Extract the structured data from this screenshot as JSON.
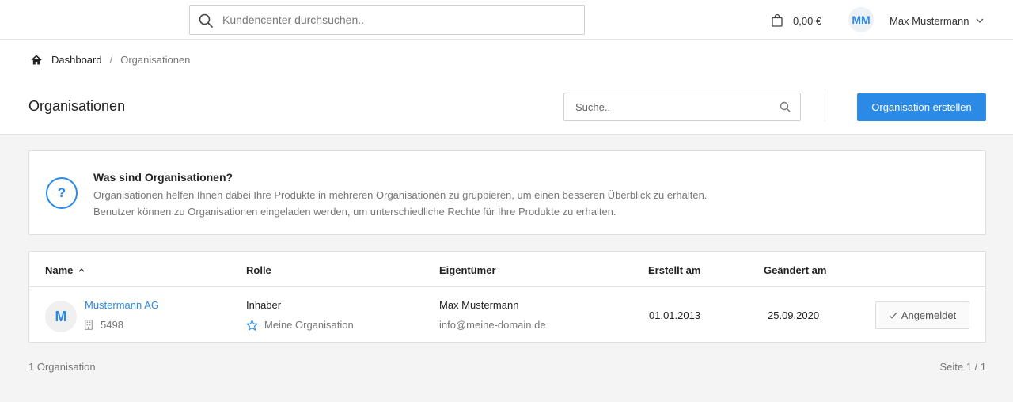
{
  "topbar": {
    "search_placeholder": "Kundencenter durchsuchen..",
    "cart_total": "0,00 €",
    "user_initials": "MM",
    "user_name": "Max Mustermann"
  },
  "breadcrumb": {
    "home_label": "Dashboard",
    "separator": "/",
    "current": "Organisationen"
  },
  "page": {
    "title": "Organisationen",
    "search_placeholder": "Suche..",
    "create_button": "Organisation erstellen"
  },
  "info": {
    "icon": "question-icon",
    "icon_glyph": "?",
    "title": "Was sind Organisationen?",
    "line1": "Organisationen helfen Ihnen dabei Ihre Produkte in mehreren Organisationen zu gruppieren, um einen besseren Überblick zu erhalten.",
    "line2": "Benutzer können zu Organisationen eingeladen werden, um unterschiedliche Rechte für Ihre Produkte zu erhalten."
  },
  "table": {
    "columns": {
      "name": "Name",
      "role": "Rolle",
      "owner": "Eigentümer",
      "created": "Erstellt am",
      "changed": "Geändert am"
    },
    "rows": [
      {
        "avatar_letter": "M",
        "name": "Mustermann AG",
        "id": "5498",
        "role": "Inhaber",
        "role_tag": "Meine Organisation",
        "owner_name": "Max Mustermann",
        "owner_email": "info@meine-domain.de",
        "created": "01.01.2013",
        "changed": "25.09.2020",
        "status": "Angemeldet"
      }
    ]
  },
  "footer": {
    "count": "1 Organisation",
    "pagination": "Seite 1 / 1"
  },
  "colors": {
    "accent": "#2b8ae6",
    "background": "#f4f4f4",
    "muted_text": "#777777"
  }
}
